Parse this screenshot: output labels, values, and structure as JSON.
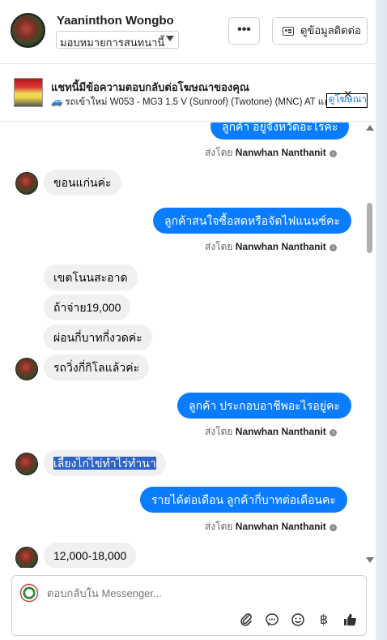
{
  "header": {
    "name": "Yaaninthon Wongbo",
    "assign_label": "มอบหมายการสนทนานี้",
    "more_label": "•••",
    "contact_label": "ดูข้อมูลติดต่อ"
  },
  "ad": {
    "title": "แชทนี้มีข้อความตอบกลับต่อโฆษณาของคุณ",
    "subtitle": "รถเข้าใหม่ W053 - MG3 1.5 V (Sunroof) (Twotone) (MNC) AT แฮทช์...",
    "view_ad_label": "ดูโฆษณา",
    "close_label": "✕"
  },
  "sender_prefix": "ส่งโดย",
  "sender_name": "Nanwhan Nanthanit",
  "messages": [
    {
      "dir": "out",
      "text": "ลูกค้า อยู่จังหวัดอะไรคะ",
      "sent_by": true
    },
    {
      "dir": "in",
      "text": "ขอนแก่นค่ะ",
      "avatar": true
    },
    {
      "dir": "out",
      "text": "ลูกค้าสนใจซื้อสดหรือจัดไฟแนนซ์คะ",
      "sent_by": true
    },
    {
      "dir": "in",
      "text": "เขตโนนสะอาด"
    },
    {
      "dir": "in",
      "text": "ถ้าจ่าย19,000"
    },
    {
      "dir": "in",
      "text": "ผ่อนกี่บาทกี่งวดค่ะ"
    },
    {
      "dir": "in",
      "text": "รถวิ่งกี่กิโลแล้วค่ะ",
      "avatar": true
    },
    {
      "dir": "out",
      "text": "ลูกค้า ประกอบอาชีพอะไรอยู่คะ",
      "sent_by": true
    },
    {
      "dir": "in",
      "text": "เลี้ยงไก่ไข่ทำไร่ทำนา",
      "avatar": true,
      "selected": true
    },
    {
      "dir": "out",
      "text": "รายได้ต่อเดือน  ลูกค้ากี่บาทต่อเดือนคะ",
      "sent_by": true
    },
    {
      "dir": "in",
      "text": "12,000-18,000",
      "avatar": true
    }
  ],
  "composer": {
    "placeholder": "ตอบกลับใน Messenger..."
  },
  "toolbar_icons": [
    "attachment-icon",
    "saved-reply-icon",
    "emoji-icon",
    "baht-payment-icon",
    "thumbs-up-icon"
  ]
}
